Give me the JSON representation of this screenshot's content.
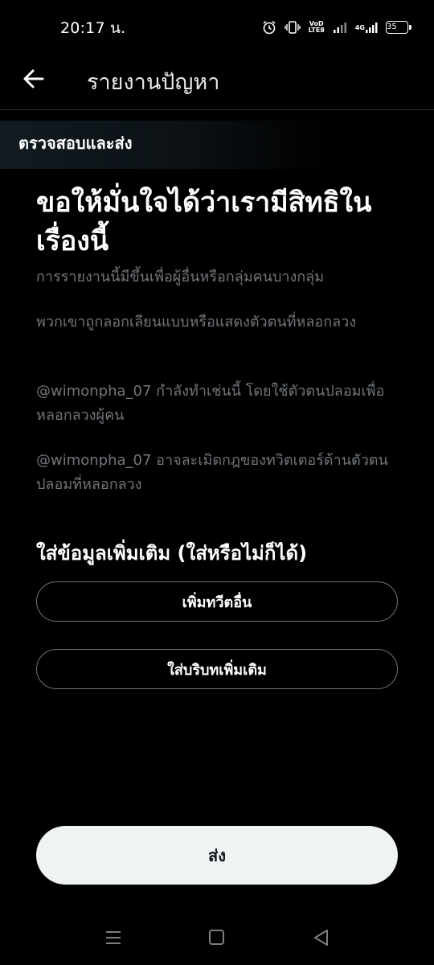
{
  "status": {
    "time": "20:17 น.",
    "volte_top": "VoD",
    "volte_bottom": "LTE8",
    "network": "4G",
    "battery": "35"
  },
  "topbar": {
    "title": "รายงานปัญหา"
  },
  "section": {
    "title": "ตรวจสอบและส่ง"
  },
  "main": {
    "headline": "ขอให้มั่นใจได้ว่าเรามีสิทธิในเรื่องนี้",
    "paragraphs": [
      "การรายงานนี้มีขึ้นเพื่อผู้อื่นหรือกลุ่มคนบางกลุ่ม",
      "พวกเขาถูกลอกเลียนแบบหรือแสดงตัวตนที่หลอกลวง",
      "@wimonpha_07 กำลังทำเช่นนี้ โดยใช้ตัวตนปลอมเพื่อหลอกลวงผู้คน",
      "@wimonpha_07 อาจละเมิดกฎของทวิตเตอร์ด้านตัวตนปลอมที่หลอกลวง"
    ],
    "extra_heading": "ใส่ข้อมูลเพิ่มเติม (ใส่หรือไม่ก็ได้)",
    "add_tweet_label": "เพิ่มทวีตอื่น",
    "add_context_label": "ใส่บริบทเพิ่มเติม",
    "send_label": "ส่ง"
  },
  "icons": {
    "back": "arrow-left-icon",
    "nav_menu": "menu-icon",
    "nav_home": "square-icon",
    "nav_back": "triangle-back-icon"
  },
  "colors": {
    "background": "#000000",
    "muted_text": "#71767b",
    "button_border": "#6e767d",
    "send_bg": "#eff3f4"
  }
}
